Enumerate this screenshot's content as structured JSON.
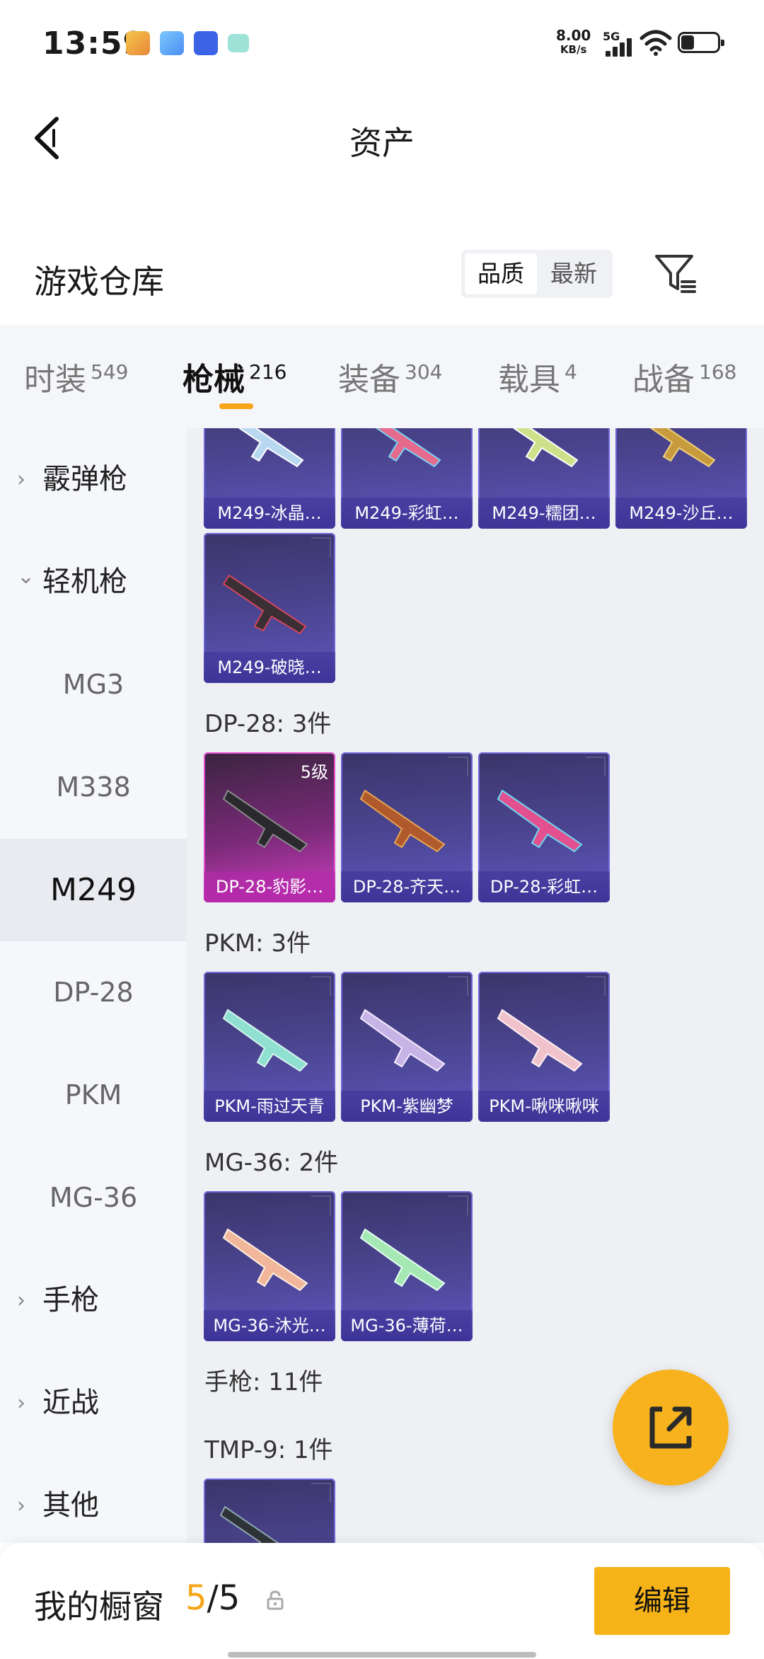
{
  "status": {
    "time": "13:59",
    "net_speed": "8.00",
    "net_unit": "KB/s",
    "signal": "5G",
    "icons": [
      "news-app-icon",
      "browser-app-icon",
      "vivo-app-icon",
      "message-app-icon"
    ]
  },
  "header": {
    "title": "资产",
    "back_icon": "back-arrow-icon"
  },
  "warehouse": {
    "title": "游戏仓库",
    "sort_quality": "品质",
    "sort_newest": "最新",
    "filter_icon": "filter-icon"
  },
  "tabs": [
    {
      "label": "时装",
      "count": "549"
    },
    {
      "label": "枪械",
      "count": "216"
    },
    {
      "label": "装备",
      "count": "304"
    },
    {
      "label": "载具",
      "count": "4"
    },
    {
      "label": "战备",
      "count": "168"
    }
  ],
  "sidebar": {
    "shotgun": "霰弹枪",
    "lmg": "轻机枪",
    "mg3": "MG3",
    "m338": "M338",
    "m249": "M249",
    "dp28": "DP-28",
    "pkm": "PKM",
    "mg36": "MG-36",
    "pistol": "手枪",
    "melee": "近战",
    "other": "其他",
    "chev_right": "›",
    "chev_down": "⌄"
  },
  "content": {
    "m249_row1": [
      "M249-冰晶…",
      "M249-彩虹…",
      "M249-糯团…",
      "M249-沙丘…"
    ],
    "m249_row2": [
      "M249-破晓…"
    ],
    "dp28_header": "DP-28: 3件",
    "dp28": [
      "DP-28-豹影…",
      "DP-28-齐天…",
      "DP-28-彩虹…"
    ],
    "dp28_badge": "5级",
    "pkm_header": "PKM: 3件",
    "pkm": [
      "PKM-雨过天青",
      "PKM-紫幽梦",
      "PKM-啾咪啾咪"
    ],
    "mg36_header": "MG-36: 2件",
    "mg36": [
      "MG-36-沐光…",
      "MG-36-薄荷…"
    ],
    "pistol_header": "手枪: 11件",
    "tmp9_header": "TMP-9: 1件"
  },
  "fab": {
    "icon": "share-external-icon"
  },
  "showcase": {
    "title": "我的橱窗",
    "current": "5",
    "sep": "/",
    "total": "5",
    "lock_icon": "lock-icon",
    "edit_label": "编辑"
  },
  "colors": {
    "accent": "#f5a516",
    "card": "#4c4694",
    "card_rare": "#d23fc3"
  }
}
